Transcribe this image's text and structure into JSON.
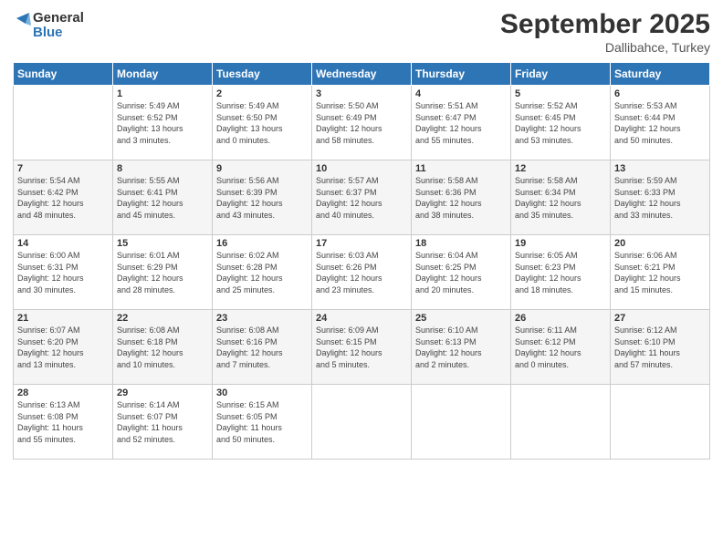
{
  "logo": {
    "line1": "General",
    "line2": "Blue"
  },
  "title": "September 2025",
  "subtitle": "Dallibahce, Turkey",
  "days": [
    "Sunday",
    "Monday",
    "Tuesday",
    "Wednesday",
    "Thursday",
    "Friday",
    "Saturday"
  ],
  "weeks": [
    [
      {
        "day": "",
        "info": ""
      },
      {
        "day": "1",
        "info": "Sunrise: 5:49 AM\nSunset: 6:52 PM\nDaylight: 13 hours\nand 3 minutes."
      },
      {
        "day": "2",
        "info": "Sunrise: 5:49 AM\nSunset: 6:50 PM\nDaylight: 13 hours\nand 0 minutes."
      },
      {
        "day": "3",
        "info": "Sunrise: 5:50 AM\nSunset: 6:49 PM\nDaylight: 12 hours\nand 58 minutes."
      },
      {
        "day": "4",
        "info": "Sunrise: 5:51 AM\nSunset: 6:47 PM\nDaylight: 12 hours\nand 55 minutes."
      },
      {
        "day": "5",
        "info": "Sunrise: 5:52 AM\nSunset: 6:45 PM\nDaylight: 12 hours\nand 53 minutes."
      },
      {
        "day": "6",
        "info": "Sunrise: 5:53 AM\nSunset: 6:44 PM\nDaylight: 12 hours\nand 50 minutes."
      }
    ],
    [
      {
        "day": "7",
        "info": "Sunrise: 5:54 AM\nSunset: 6:42 PM\nDaylight: 12 hours\nand 48 minutes."
      },
      {
        "day": "8",
        "info": "Sunrise: 5:55 AM\nSunset: 6:41 PM\nDaylight: 12 hours\nand 45 minutes."
      },
      {
        "day": "9",
        "info": "Sunrise: 5:56 AM\nSunset: 6:39 PM\nDaylight: 12 hours\nand 43 minutes."
      },
      {
        "day": "10",
        "info": "Sunrise: 5:57 AM\nSunset: 6:37 PM\nDaylight: 12 hours\nand 40 minutes."
      },
      {
        "day": "11",
        "info": "Sunrise: 5:58 AM\nSunset: 6:36 PM\nDaylight: 12 hours\nand 38 minutes."
      },
      {
        "day": "12",
        "info": "Sunrise: 5:58 AM\nSunset: 6:34 PM\nDaylight: 12 hours\nand 35 minutes."
      },
      {
        "day": "13",
        "info": "Sunrise: 5:59 AM\nSunset: 6:33 PM\nDaylight: 12 hours\nand 33 minutes."
      }
    ],
    [
      {
        "day": "14",
        "info": "Sunrise: 6:00 AM\nSunset: 6:31 PM\nDaylight: 12 hours\nand 30 minutes."
      },
      {
        "day": "15",
        "info": "Sunrise: 6:01 AM\nSunset: 6:29 PM\nDaylight: 12 hours\nand 28 minutes."
      },
      {
        "day": "16",
        "info": "Sunrise: 6:02 AM\nSunset: 6:28 PM\nDaylight: 12 hours\nand 25 minutes."
      },
      {
        "day": "17",
        "info": "Sunrise: 6:03 AM\nSunset: 6:26 PM\nDaylight: 12 hours\nand 23 minutes."
      },
      {
        "day": "18",
        "info": "Sunrise: 6:04 AM\nSunset: 6:25 PM\nDaylight: 12 hours\nand 20 minutes."
      },
      {
        "day": "19",
        "info": "Sunrise: 6:05 AM\nSunset: 6:23 PM\nDaylight: 12 hours\nand 18 minutes."
      },
      {
        "day": "20",
        "info": "Sunrise: 6:06 AM\nSunset: 6:21 PM\nDaylight: 12 hours\nand 15 minutes."
      }
    ],
    [
      {
        "day": "21",
        "info": "Sunrise: 6:07 AM\nSunset: 6:20 PM\nDaylight: 12 hours\nand 13 minutes."
      },
      {
        "day": "22",
        "info": "Sunrise: 6:08 AM\nSunset: 6:18 PM\nDaylight: 12 hours\nand 10 minutes."
      },
      {
        "day": "23",
        "info": "Sunrise: 6:08 AM\nSunset: 6:16 PM\nDaylight: 12 hours\nand 7 minutes."
      },
      {
        "day": "24",
        "info": "Sunrise: 6:09 AM\nSunset: 6:15 PM\nDaylight: 12 hours\nand 5 minutes."
      },
      {
        "day": "25",
        "info": "Sunrise: 6:10 AM\nSunset: 6:13 PM\nDaylight: 12 hours\nand 2 minutes."
      },
      {
        "day": "26",
        "info": "Sunrise: 6:11 AM\nSunset: 6:12 PM\nDaylight: 12 hours\nand 0 minutes."
      },
      {
        "day": "27",
        "info": "Sunrise: 6:12 AM\nSunset: 6:10 PM\nDaylight: 11 hours\nand 57 minutes."
      }
    ],
    [
      {
        "day": "28",
        "info": "Sunrise: 6:13 AM\nSunset: 6:08 PM\nDaylight: 11 hours\nand 55 minutes."
      },
      {
        "day": "29",
        "info": "Sunrise: 6:14 AM\nSunset: 6:07 PM\nDaylight: 11 hours\nand 52 minutes."
      },
      {
        "day": "30",
        "info": "Sunrise: 6:15 AM\nSunset: 6:05 PM\nDaylight: 11 hours\nand 50 minutes."
      },
      {
        "day": "",
        "info": ""
      },
      {
        "day": "",
        "info": ""
      },
      {
        "day": "",
        "info": ""
      },
      {
        "day": "",
        "info": ""
      }
    ]
  ]
}
